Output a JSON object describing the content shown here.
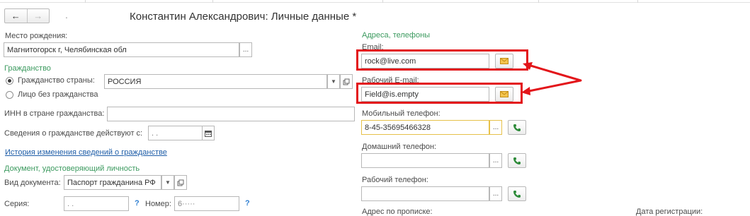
{
  "header": {
    "back": "←",
    "forward": "→",
    "blurred_name": ". ",
    "title": "Константин Александрович: Личные данные *"
  },
  "left": {
    "birthplace": {
      "label": "Место рождения:",
      "value": "Магнитогорск г, Челябинская обл",
      "button": "..."
    },
    "citizenship": {
      "section": "Гражданство",
      "option_country": "Гражданство страны:",
      "country_value": "РОССИЯ",
      "option_stateless": "Лицо без гражданства",
      "inn_label": "ИНН в стране гражданства:",
      "inn_value": "",
      "valid_label": "Сведения о гражданстве действуют с:",
      "valid_value": "  .  .",
      "history_link": "История изменения сведений о гражданстве"
    },
    "document": {
      "section": "Документ, удостоверяющий личность",
      "type_label": "Вид документа:",
      "type_value": "Паспорт гражданина РФ",
      "series_label": "Серия:",
      "series_value": "  .  .",
      "number_label": "Номер:",
      "number_value": "6·····",
      "help": "?"
    }
  },
  "right": {
    "section": "Адреса, телефоны",
    "email_label": "Email:",
    "email_value": "rock@live.com",
    "work_email_label": "Рабочий E-mail:",
    "work_email_value": "Field@is.empty",
    "mobile_label": "Мобильный телефон:",
    "mobile_value": "8-45-35695466328",
    "home_label": "Домашний телефон:",
    "home_value": "",
    "work_phone_label": "Рабочий телефон:",
    "work_phone_value": "",
    "address_label": "Адрес по прописке:",
    "reg_date_label": "Дата регистрации:",
    "dots": "..."
  },
  "colors": {
    "annotation": "#e3151a",
    "section_green": "#3c9a5f",
    "link_blue": "#1f5ea8",
    "phone_green": "#2e8b3a",
    "envelope": "#e8b32f"
  }
}
